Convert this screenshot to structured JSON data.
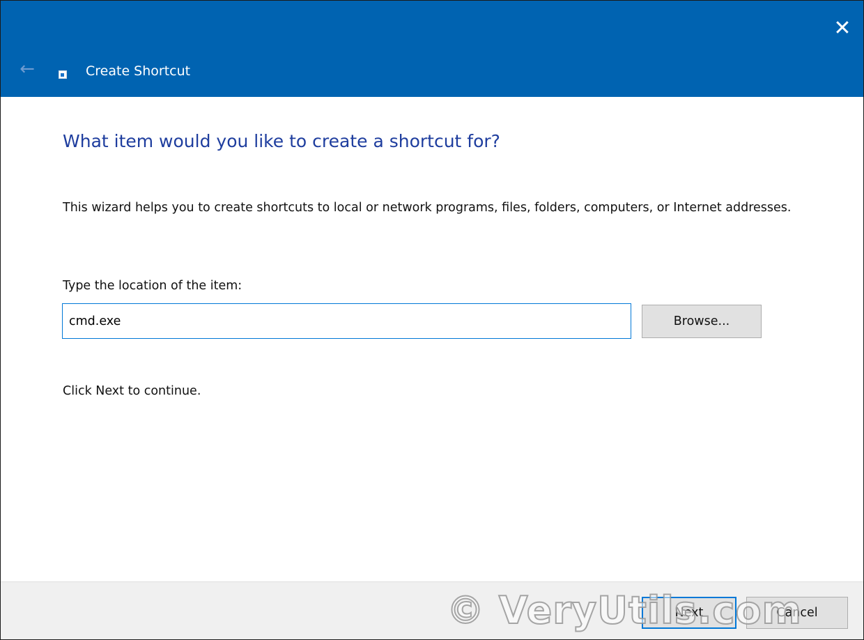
{
  "window": {
    "title": "Create Shortcut",
    "close_symbol": "✕",
    "back_symbol": "←",
    "icons": {
      "close": "close-icon",
      "back": "back-arrow-icon",
      "app": "shortcut-icon"
    }
  },
  "wizard": {
    "heading": "What item would you like to create a shortcut for?",
    "description": "This wizard helps you to create shortcuts to local or network programs, files, folders, computers, or Internet addresses.",
    "location_label": "Type the location of the item:",
    "location_value": "cmd.exe",
    "browse_label": "Browse...",
    "hint": "Click Next to continue."
  },
  "footer": {
    "next_label": "Next",
    "cancel_label": "Cancel"
  },
  "watermark": "© VeryUtils.com",
  "colors": {
    "titlebar": "#0063b1",
    "heading": "#1e3d9e",
    "focus_border": "#0078d7",
    "footer": "#f0f0f0"
  }
}
